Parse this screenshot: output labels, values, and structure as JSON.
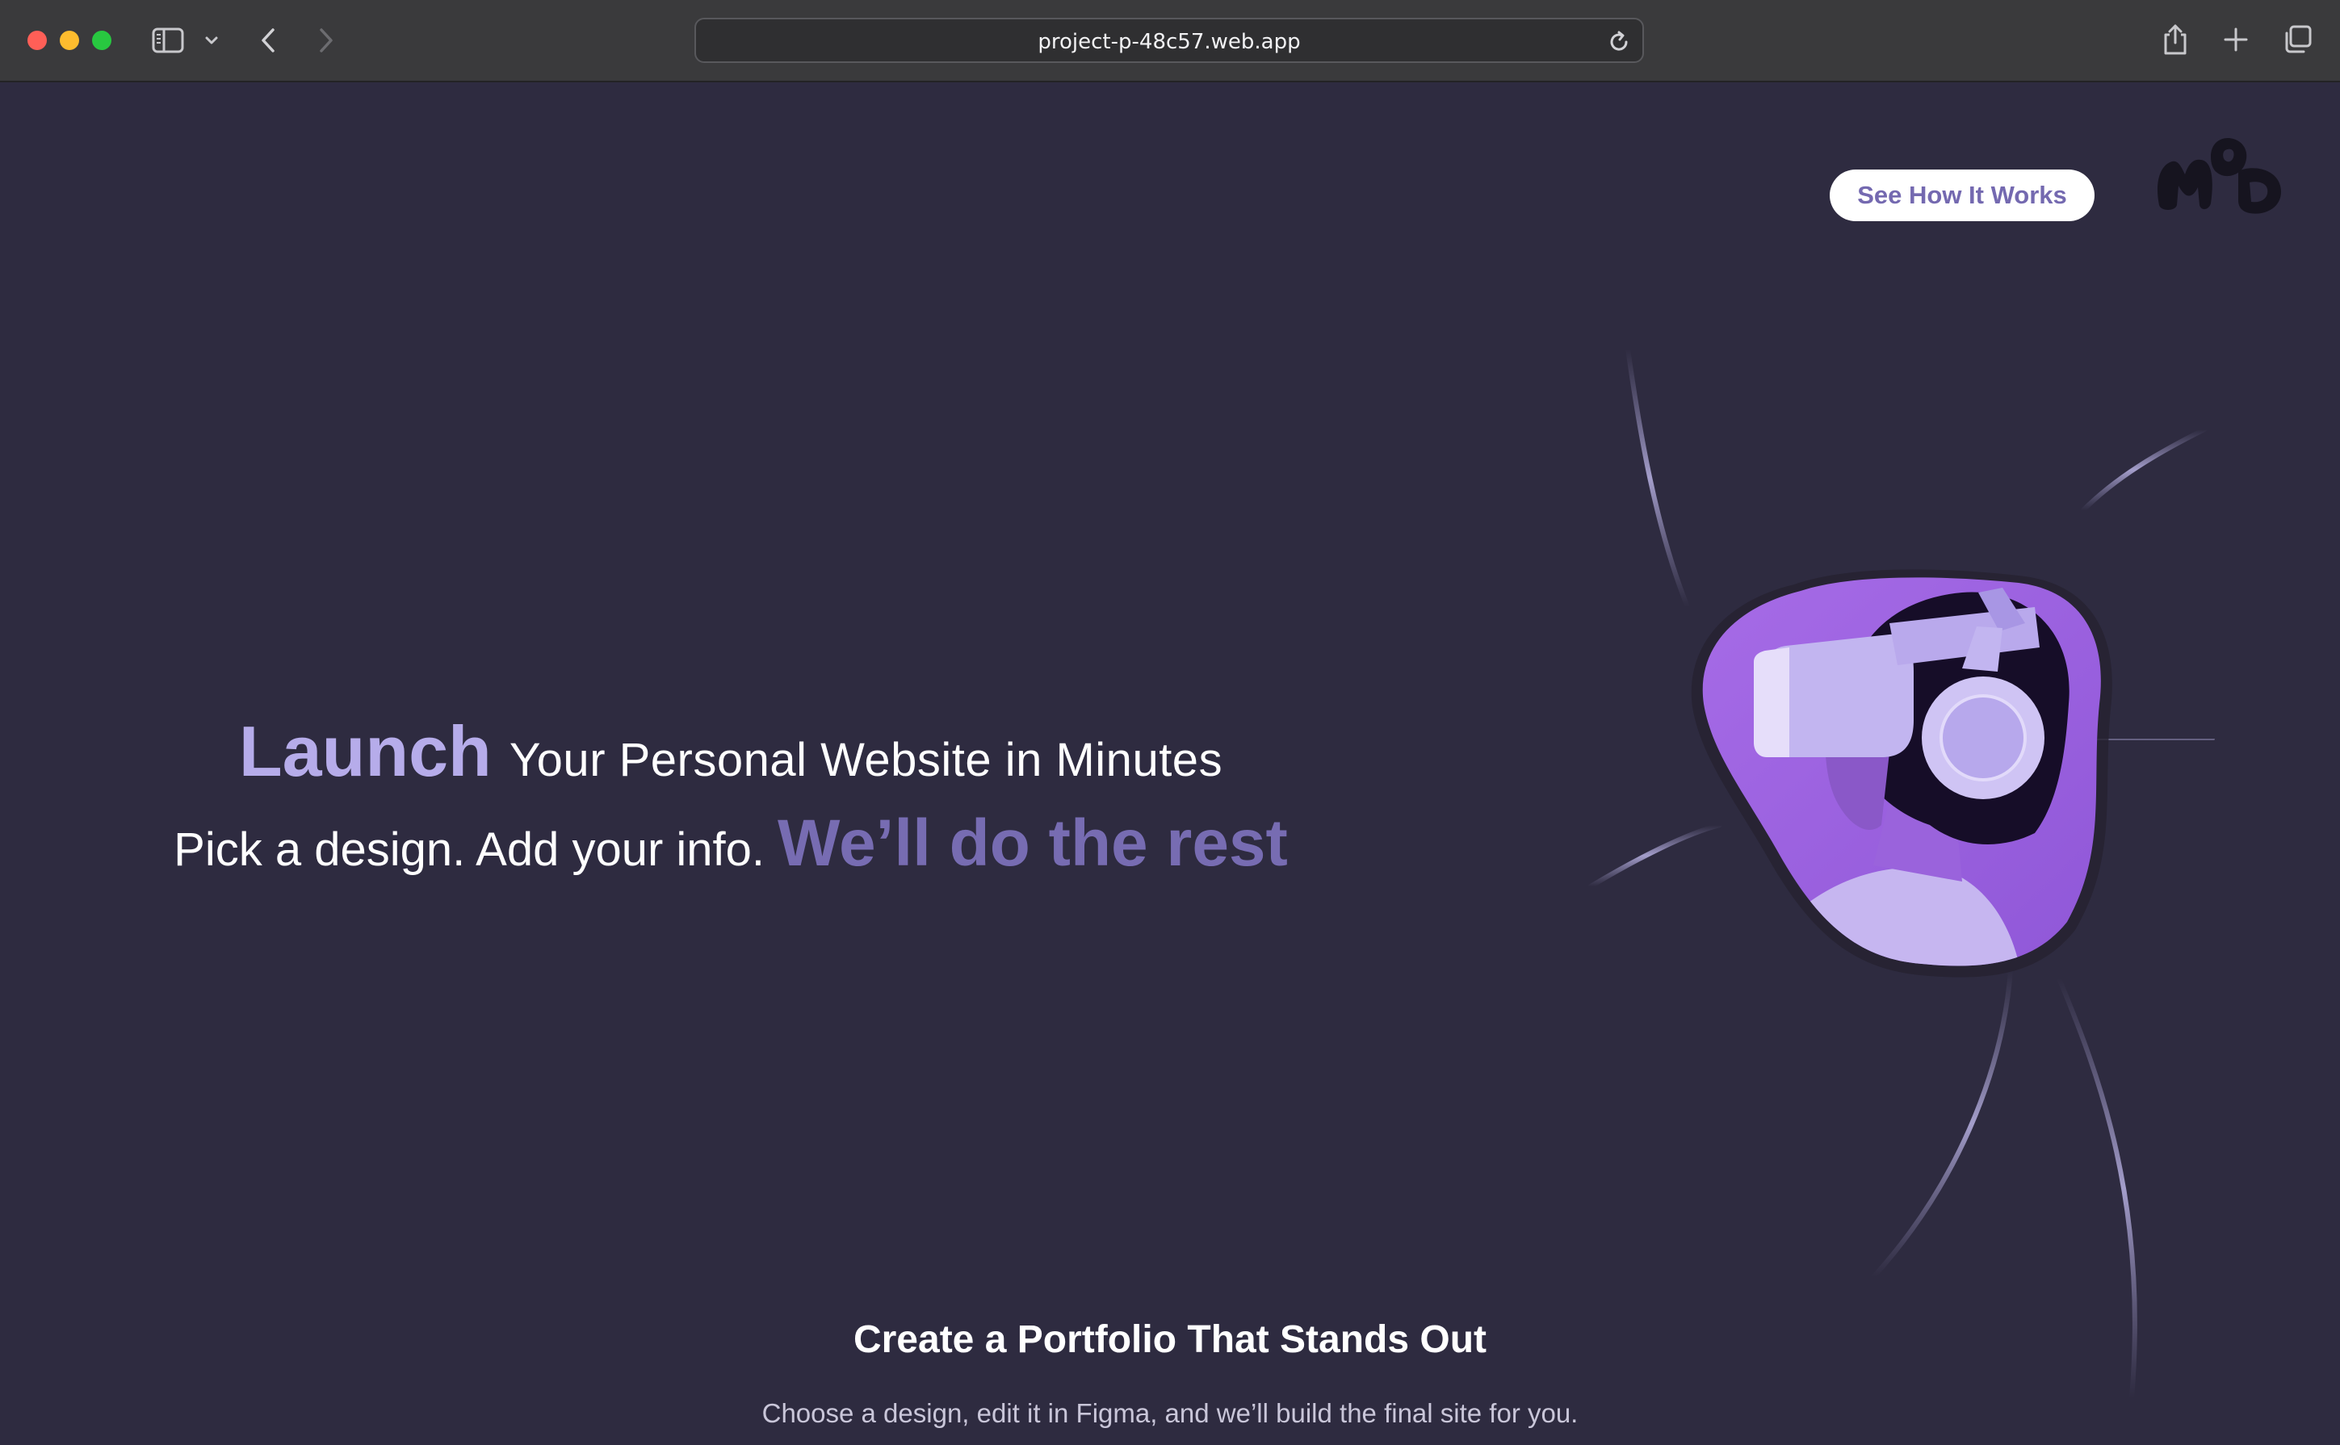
{
  "browser": {
    "url": "project-p-48c57.web.app"
  },
  "header": {
    "cta_label": "See How It Works",
    "logo_alt": "MOD logo"
  },
  "hero": {
    "headline_strong": "Launch",
    "headline_rest": "Your Personal Website in Minutes",
    "subline_plain": "Pick a design. Add your info.",
    "subline_accent": "We’ll do the rest"
  },
  "section": {
    "title": "Create a Portfolio That Stands Out",
    "subtitle": "Choose a design, edit it in Figma, and we’ll build the final site for you."
  },
  "colors": {
    "page_background": "#2e2b40",
    "accent_light": "#b6acea",
    "accent": "#776cb2",
    "blob_purple": "#9a5ee0"
  },
  "icons": {
    "sidebar": "sidebar-icon",
    "chevron": "chevron-down-icon",
    "back": "chevron-left-icon",
    "forward": "chevron-right-icon",
    "reload": "reload-icon",
    "share": "share-icon",
    "new_tab": "plus-icon",
    "tabs": "tabs-overview-icon"
  }
}
